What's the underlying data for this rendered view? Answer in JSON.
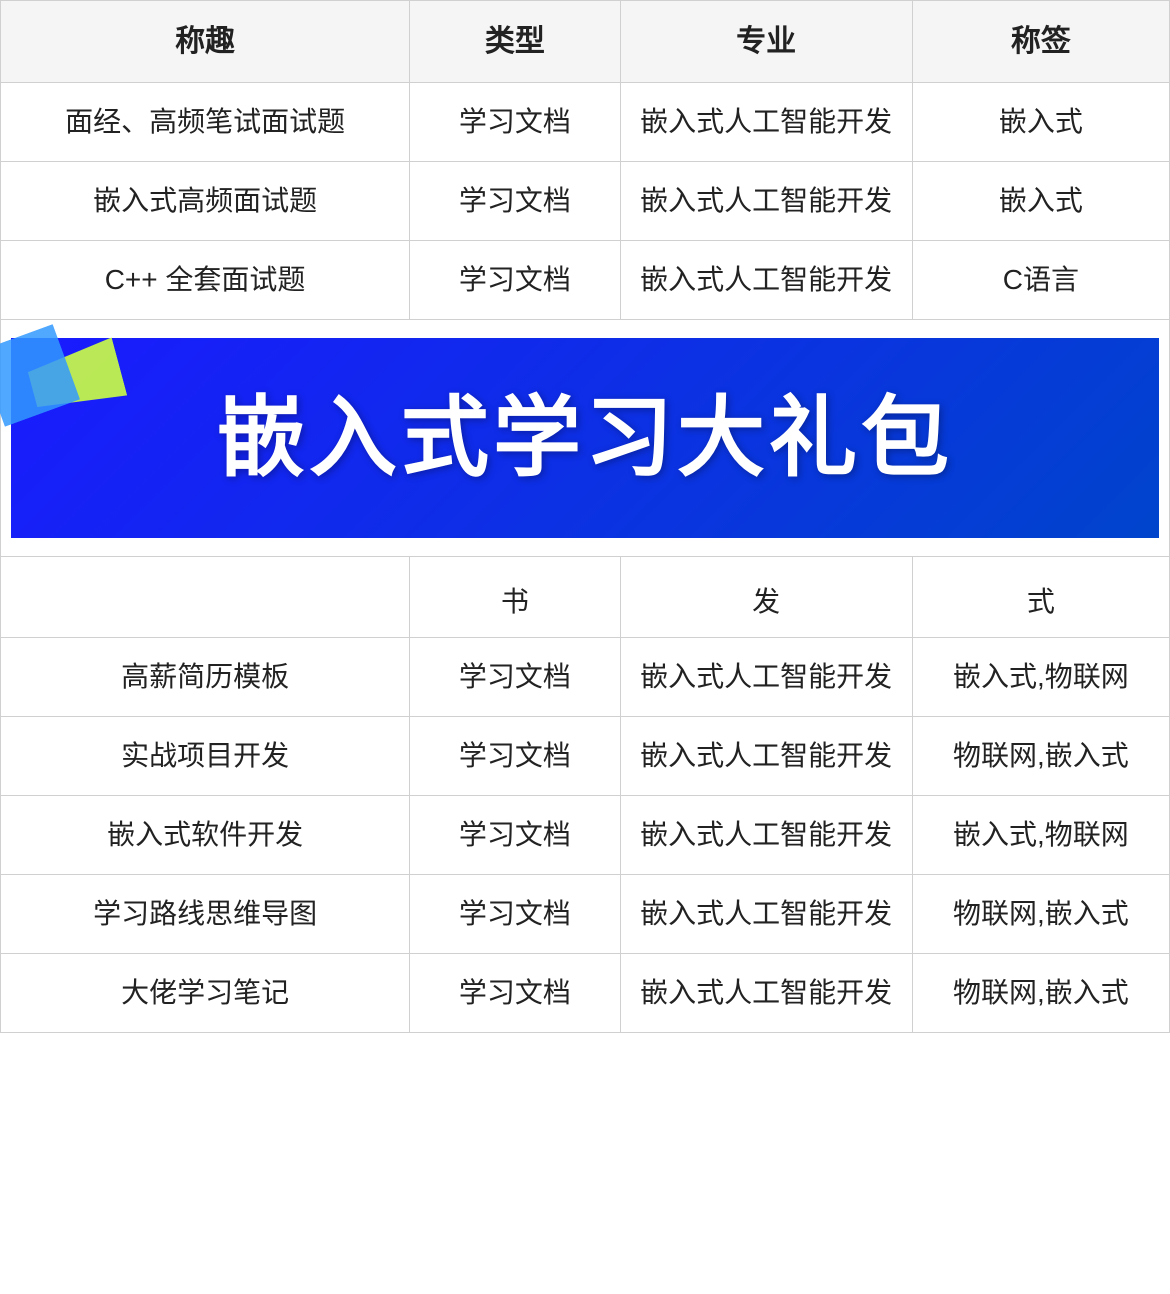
{
  "table": {
    "headers": [
      "称趣",
      "类型",
      "专业",
      "称签"
    ],
    "rows": [
      {
        "name": "面经、高频笔试面试题",
        "type": "学习文档",
        "major": "嵌入式人工智能开发",
        "tag": "嵌入式"
      },
      {
        "name": "嵌入式高频面试题",
        "type": "学习文档",
        "major": "嵌入式人工智能开发",
        "tag": "嵌入式"
      },
      {
        "name": "C++ 全套面试题",
        "type": "学习文档",
        "major": "嵌入式人工智能开发",
        "tag": "C语言"
      }
    ],
    "partial_row": {
      "name": "",
      "type": "书",
      "major": "发",
      "tag": "式"
    },
    "rows_after_banner": [
      {
        "name": "高薪简历模板",
        "type": "学习文档",
        "major": "嵌入式人工智能开发",
        "tag": "嵌入式,物联网"
      },
      {
        "name": "实战项目开发",
        "type": "学习文档",
        "major": "嵌入式人工智能开发",
        "tag": "物联网,嵌入式"
      },
      {
        "name": "嵌入式软件开发",
        "type": "学习文档",
        "major": "嵌入式人工智能开发",
        "tag": "嵌入式,物联网"
      },
      {
        "name": "学习路线思维导图",
        "type": "学习文档",
        "major": "嵌入式人工智能开发",
        "tag": "物联网,嵌入式"
      },
      {
        "name": "大佬学习笔记",
        "type": "学习文档",
        "major": "嵌入式人工智能开发",
        "tag": "物联网,嵌入式"
      }
    ],
    "banner_text": "嵌入式学习大礼包"
  }
}
